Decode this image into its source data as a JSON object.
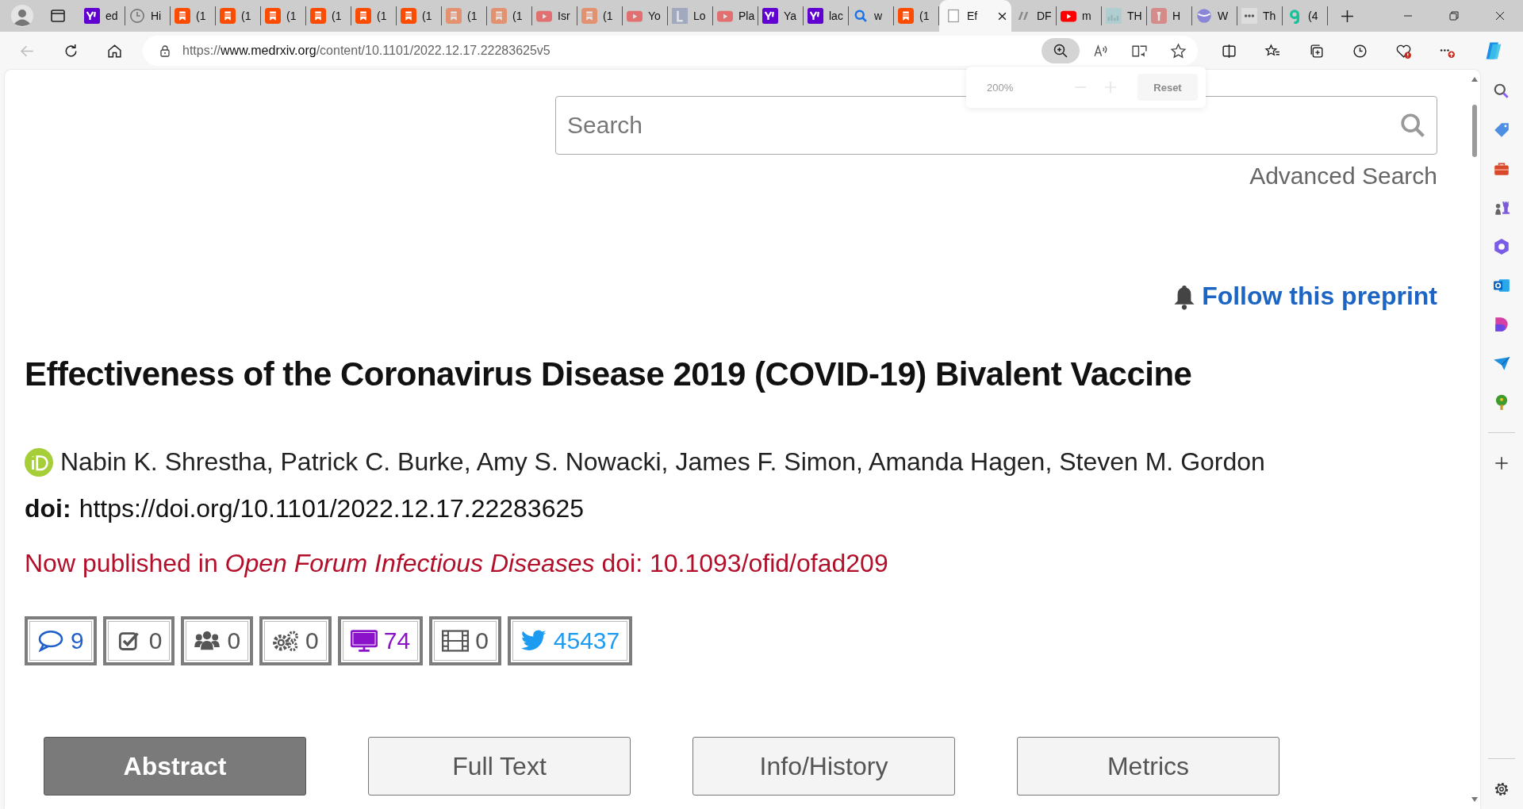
{
  "browser": {
    "tabs": [
      {
        "kind": "yahoo",
        "label": "ed",
        "selected": false,
        "sleeping": false
      },
      {
        "kind": "history",
        "label": "Hi",
        "selected": false,
        "sleeping": false
      },
      {
        "kind": "bookmark",
        "label": "(1",
        "selected": false,
        "sleeping": false
      },
      {
        "kind": "bookmark",
        "label": "(1",
        "selected": false,
        "sleeping": false
      },
      {
        "kind": "bookmark",
        "label": "(1",
        "selected": false,
        "sleeping": false
      },
      {
        "kind": "bookmark",
        "label": "(1",
        "selected": false,
        "sleeping": false
      },
      {
        "kind": "bookmark",
        "label": "(1",
        "selected": false,
        "sleeping": false
      },
      {
        "kind": "bookmark",
        "label": "(1",
        "selected": false,
        "sleeping": false
      },
      {
        "kind": "bookmark",
        "label": "(1",
        "selected": false,
        "sleeping": true
      },
      {
        "kind": "bookmark",
        "label": "(1",
        "selected": false,
        "sleeping": true
      },
      {
        "kind": "video",
        "label": "Isr",
        "selected": false,
        "sleeping": true
      },
      {
        "kind": "bookmark",
        "label": "(1",
        "selected": false,
        "sleeping": true
      },
      {
        "kind": "video",
        "label": "Yo",
        "selected": false,
        "sleeping": true
      },
      {
        "kind": "letter",
        "label": "Lo",
        "selected": false,
        "sleeping": true
      },
      {
        "kind": "video",
        "label": "Pla",
        "selected": false,
        "sleeping": true
      },
      {
        "kind": "yahoo",
        "label": "Ya",
        "selected": false,
        "sleeping": false
      },
      {
        "kind": "yahoo",
        "label": "lac",
        "selected": false,
        "sleeping": false
      },
      {
        "kind": "search",
        "label": "w",
        "selected": false,
        "sleeping": false
      },
      {
        "kind": "bookmark",
        "label": "(1",
        "selected": false,
        "sleeping": false
      },
      {
        "kind": "page",
        "label": "Ef",
        "selected": true,
        "sleeping": false
      },
      {
        "kind": "italic",
        "label": "DF",
        "selected": false,
        "sleeping": false
      },
      {
        "kind": "video",
        "label": "m",
        "selected": false,
        "sleeping": false
      },
      {
        "kind": "chart",
        "label": "TH",
        "selected": false,
        "sleeping": true
      },
      {
        "kind": "torch",
        "label": "H",
        "selected": false,
        "sleeping": true
      },
      {
        "kind": "shield",
        "label": "W",
        "selected": false,
        "sleeping": false
      },
      {
        "kind": "dots",
        "label": "Th",
        "selected": false,
        "sleeping": false
      },
      {
        "kind": "g",
        "label": "(4",
        "selected": false,
        "sleeping": false
      }
    ],
    "address_bar": {
      "scheme": "https://",
      "host": "www.medrxiv.org",
      "path": "/content/10.1101/2022.12.17.22283625v5"
    },
    "zoom_popup": {
      "zoom_level": "200%",
      "reset_button": "Reset"
    }
  },
  "page": {
    "search": {
      "placeholder": "Search"
    },
    "advanced_search": "Advanced Search",
    "follow_link": "Follow this preprint",
    "title": "Effectiveness of the Coronavirus Disease 2019 (COVID-19) Bivalent Vaccine",
    "authors": "Nabin K. Shrestha, Patrick C. Burke, Amy S. Nowacki, James F. Simon, Amanda Hagen, Steven M. Gordon",
    "doi_label": "doi:",
    "doi_url": "https://doi.org/10.1101/2022.12.17.22283625",
    "published_note": "Now published in *Open Forum Infectious Diseases* doi: 10.1093/ofid/ofad209",
    "metrics": [
      {
        "kind": "comments",
        "count": "9",
        "color": "#1f5fc9"
      },
      {
        "kind": "reviews",
        "count": "0",
        "color": "#555555"
      },
      {
        "kind": "community",
        "count": "0",
        "color": "#555555"
      },
      {
        "kind": "automated",
        "count": "0",
        "color": "#555555"
      },
      {
        "kind": "blogs",
        "count": "74",
        "color": "#8b12c9"
      },
      {
        "kind": "media",
        "count": "0",
        "color": "#555555"
      },
      {
        "kind": "twitter",
        "count": "45437",
        "color": "#1d9bf0"
      }
    ],
    "tabs": [
      {
        "label": "Abstract",
        "selected": true
      },
      {
        "label": "Full Text",
        "selected": false
      },
      {
        "label": "Info/History",
        "selected": false
      },
      {
        "label": "Metrics",
        "selected": false
      }
    ]
  }
}
